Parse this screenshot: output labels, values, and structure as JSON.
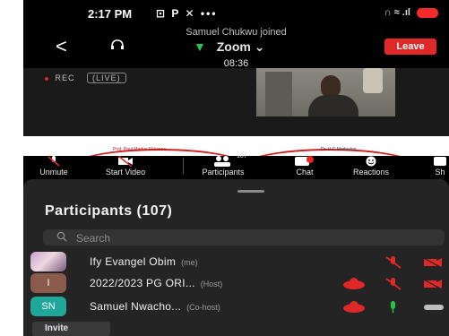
{
  "status_bar": {
    "time": "2:17 PM",
    "left_icons": "⊡ P ✕ •••",
    "right_icons": "∩ ≈ .ıl"
  },
  "notification": "Samuel Chukwu joined",
  "meeting": {
    "title": "Zoom",
    "duration": "08:36",
    "leave_label": "Leave",
    "rec_label": "REC",
    "live_label": "LIVE"
  },
  "slide": {
    "left_caption": "Prof. Paul Madus Ekkenne",
    "right_caption": "Dr. U.C Maduskor"
  },
  "toolbar": {
    "items": [
      {
        "label": "Unmute",
        "icon": "mic-muted-icon"
      },
      {
        "label": "Start Video",
        "icon": "video-off-icon"
      },
      {
        "label": "Participants",
        "icon": "participants-icon",
        "count": "107"
      },
      {
        "label": "Chat",
        "icon": "chat-icon",
        "badge": "3"
      },
      {
        "label": "Reactions",
        "icon": "reactions-icon"
      },
      {
        "label": "Sh",
        "icon": "share-icon"
      }
    ]
  },
  "participants": {
    "title": "Participants (107)",
    "search_placeholder": "Search",
    "rows": [
      {
        "name": "Ify Evangel Obim",
        "role": "(me)",
        "avatar_initials": "",
        "avatar_color": "#c7a2c9"
      },
      {
        "name": "2022/2023 PG ORI...",
        "role": "(Host)",
        "avatar_initials": "I",
        "avatar_color": "#8a5a4c"
      },
      {
        "name": "Samuel Nwacho...",
        "role": "(Co-host)",
        "avatar_initials": "SN",
        "avatar_color": "#1fa89a"
      }
    ],
    "invite_label": "Invite"
  },
  "colors": {
    "accent_red": "#e02828",
    "mic_green": "#26c34a",
    "sheet_bg": "#242424"
  }
}
